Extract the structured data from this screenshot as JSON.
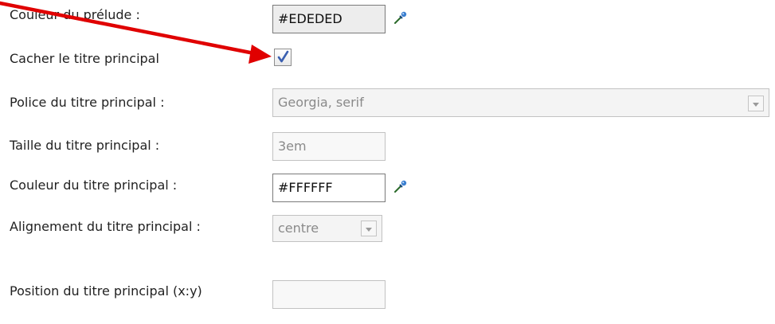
{
  "form": {
    "prelude_color": {
      "label": "Couleur du prélude :",
      "value": "#EDEDED"
    },
    "hide_main_title": {
      "label": "Cacher le titre principal",
      "checked": true
    },
    "main_title_font": {
      "label": "Police du titre principal :",
      "value": "Georgia, serif"
    },
    "main_title_size": {
      "label": "Taille du titre principal :",
      "value": "3em"
    },
    "main_title_color": {
      "label": "Couleur du titre principal :",
      "value": "#FFFFFF"
    },
    "main_title_align": {
      "label": "Alignement du titre principal :",
      "value": "centre"
    },
    "main_title_position": {
      "label": "Position du titre principal (x:y)",
      "value": ""
    }
  },
  "icons": {
    "color_picker": "eyedropper-icon",
    "checkbox_mark": "checkmark-icon",
    "select_arrow": "chevron-down-icon"
  },
  "colors": {
    "annotation_arrow": "#e00000",
    "prelude_swatch": "#EDEDED",
    "title_swatch": "#FFFFFF",
    "checkmark": "#3a5fb0"
  }
}
